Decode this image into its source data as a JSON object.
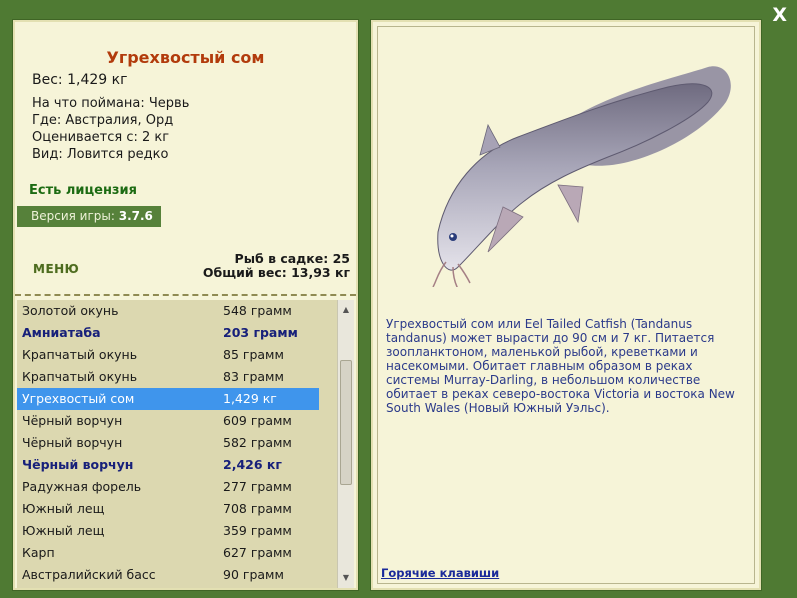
{
  "close_label": "X",
  "fish": {
    "title": "Угрехвостый сом",
    "weight_line": "Вес: 1,429 кг",
    "caught_on": "На что поймана: Червь",
    "location": "Где: Австралия, Орд",
    "valued": "Оценивается с: 2 кг",
    "kind": "Вид: Ловится редко"
  },
  "license": "Есть лицензия",
  "version": {
    "label": "Версия игры:",
    "value": "3.7.6"
  },
  "menu_label": "МЕНЮ",
  "stats": {
    "fish_count": "Рыб в садке: 25",
    "total_weight": "Общий вес: 13,93 кг"
  },
  "catch_list": [
    {
      "name": "Золотой окунь",
      "weight": "548 грамм",
      "bold": false,
      "selected": false
    },
    {
      "name": "Амниатаба",
      "weight": "203 грамм",
      "bold": true,
      "selected": false
    },
    {
      "name": "Крапчатый окунь",
      "weight": "85 грамм",
      "bold": false,
      "selected": false
    },
    {
      "name": "Крапчатый окунь",
      "weight": "83 грамм",
      "bold": false,
      "selected": false
    },
    {
      "name": "Угрехвостый сом",
      "weight": "1,429 кг",
      "bold": false,
      "selected": true
    },
    {
      "name": "Чёрный ворчун",
      "weight": "609 грамм",
      "bold": false,
      "selected": false
    },
    {
      "name": "Чёрный ворчун",
      "weight": "582 грамм",
      "bold": false,
      "selected": false
    },
    {
      "name": "Чёрный ворчун",
      "weight": "2,426 кг",
      "bold": true,
      "selected": false
    },
    {
      "name": "Радужная форель",
      "weight": "277 грамм",
      "bold": false,
      "selected": false
    },
    {
      "name": "Южный лещ",
      "weight": "708 грамм",
      "bold": false,
      "selected": false
    },
    {
      "name": "Южный лещ",
      "weight": "359 грамм",
      "bold": false,
      "selected": false
    },
    {
      "name": "Карп",
      "weight": "627 грамм",
      "bold": false,
      "selected": false
    },
    {
      "name": "Австралийский басс",
      "weight": "90 грамм",
      "bold": false,
      "selected": false
    }
  ],
  "description": "Угрехвостый сом или Eel Tailed Catfish (Tandanus tandanus) может вырасти до 90 см и 7 кг. Питается зоопланктоном, маленькой рыбой, креветками и насекомыми. Обитает главным образом в реках системы Murray-Darling, в небольшом количестве обитает в реках северо-востока Victoria и востока New South Wales (Новый Южный Уэльс).",
  "hotkeys_label": "Горячие клавиши"
}
